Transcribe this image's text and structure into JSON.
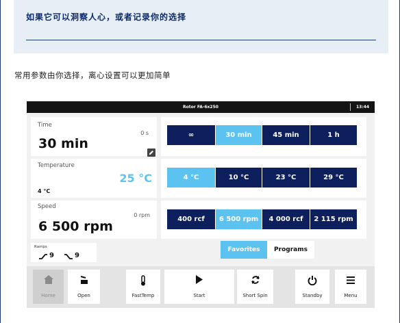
{
  "banner": {
    "title": "如果它可以洞察人心，或者记录你的选择"
  },
  "intro": "常用参数由你选择，离心设置可以更加简单",
  "device": {
    "rotor": "Rotor FA-6x250",
    "clock": "13:44",
    "time": {
      "label": "Time",
      "value": "30 min",
      "actual": "0 s"
    },
    "temperature": {
      "label": "Temperature",
      "value": "25 °C",
      "actual": "4 °C"
    },
    "speed": {
      "label": "Speed",
      "value": "6 500 rpm",
      "actual": "0 rpm"
    },
    "time_presets": [
      {
        "label": "∞",
        "selected": false
      },
      {
        "label": "30 min",
        "selected": true
      },
      {
        "label": "45 min",
        "selected": false
      },
      {
        "label": "1 h",
        "selected": false
      }
    ],
    "temp_presets": [
      {
        "label": "4 °C",
        "selected": true
      },
      {
        "label": "10 °C",
        "selected": false
      },
      {
        "label": "23 °C",
        "selected": false
      },
      {
        "label": "29 °C",
        "selected": false
      }
    ],
    "speed_presets": [
      {
        "label": "400 rcf",
        "selected": false
      },
      {
        "label": "6 500 rpm",
        "selected": true
      },
      {
        "label": "4 000 rcf",
        "selected": false
      },
      {
        "label": "2 115 rpm",
        "selected": false
      }
    ],
    "tabs": {
      "favorites": "Favorites",
      "programs": "Programs",
      "active": "Favorites"
    },
    "ramps": {
      "label": "Ramps",
      "accel": "9",
      "decel": "9"
    },
    "nav": [
      {
        "id": "home",
        "label": "Home",
        "icon": "home-icon",
        "enabled": false
      },
      {
        "id": "open",
        "label": "Open",
        "icon": "lid-open-icon",
        "enabled": true
      },
      {
        "id": "fasttemp",
        "label": "FastTemp",
        "icon": "thermometer-icon",
        "enabled": true
      },
      {
        "id": "start",
        "label": "Start",
        "icon": "play-icon",
        "enabled": true
      },
      {
        "id": "shortspin",
        "label": "Short Spin",
        "icon": "spin-icon",
        "enabled": true
      },
      {
        "id": "standby",
        "label": "Standby",
        "icon": "power-icon",
        "enabled": true
      },
      {
        "id": "menu",
        "label": "Menu",
        "icon": "menu-icon",
        "enabled": true
      }
    ]
  },
  "colors": {
    "navy": "#0d1f5c",
    "accent": "#5cc3f1",
    "banner_bg": "#e8eef6",
    "banner_text": "#0a2a6b"
  }
}
